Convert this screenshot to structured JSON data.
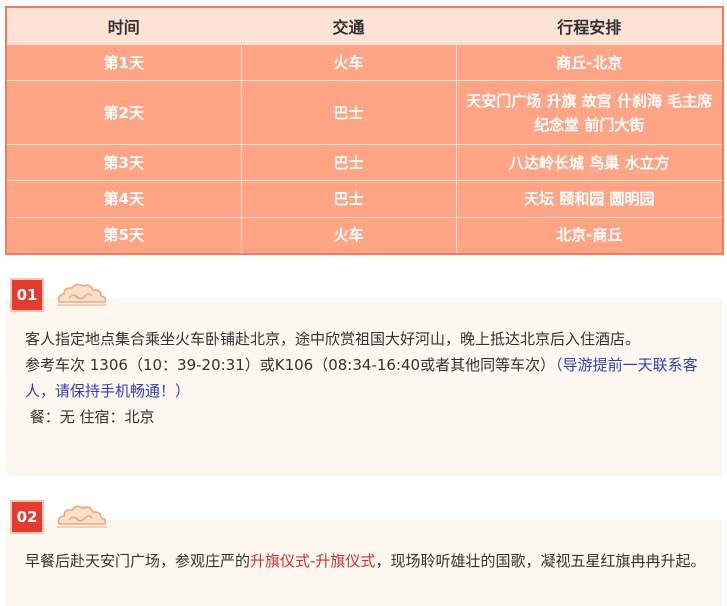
{
  "table": {
    "headers": [
      "时间",
      "交通",
      "行程安排"
    ],
    "rows": [
      {
        "day": "第1天",
        "transport": "火车",
        "plan": "商丘-北京"
      },
      {
        "day": "第2天",
        "transport": "巴士",
        "plan": "天安门广场 升旗 故宫 什刹海 毛主席纪念堂 前门大街"
      },
      {
        "day": "第3天",
        "transport": "巴士",
        "plan": "八达岭长城 鸟巢 水立方"
      },
      {
        "day": "第4天",
        "transport": "巴士",
        "plan": "天坛 颐和园 圆明园"
      },
      {
        "day": "第5天",
        "transport": "火车",
        "plan": "北京-商丘"
      }
    ]
  },
  "colors": {
    "header_bg": "#fde3d6",
    "cell_bg": "#ffa485",
    "border": "#f47c5c",
    "badge": "#e53a2f",
    "panel_bg": "#fdf7ef",
    "link_blue": "#2f3fbf",
    "highlight_red": "#d0302a"
  },
  "days": [
    {
      "badge": "01",
      "icon": "auspicious-cloud-icon",
      "line1": "客人指定地点集合乘坐火车卧铺赴北京，途中欣赏祖国大好河山，晚上抵达北京后入住酒店。",
      "line2_prefix": "参考车次 1306（10：39-20:31）或K106（08:34-16:40或者其他同等车次）",
      "line2_note": "（导游提前一天联系客人，请保持手机畅通！）",
      "meal_line": " 餐：无 住宿：北京"
    },
    {
      "badge": "02",
      "icon": "auspicious-cloud-icon",
      "text_before": "早餐后赴天安门广场，参观庄严的",
      "highlight": "升旗仪式-升旗仪式",
      "text_after": "，现场聆听雄壮的国歌，凝视五星红旗冉冉升起。"
    }
  ]
}
